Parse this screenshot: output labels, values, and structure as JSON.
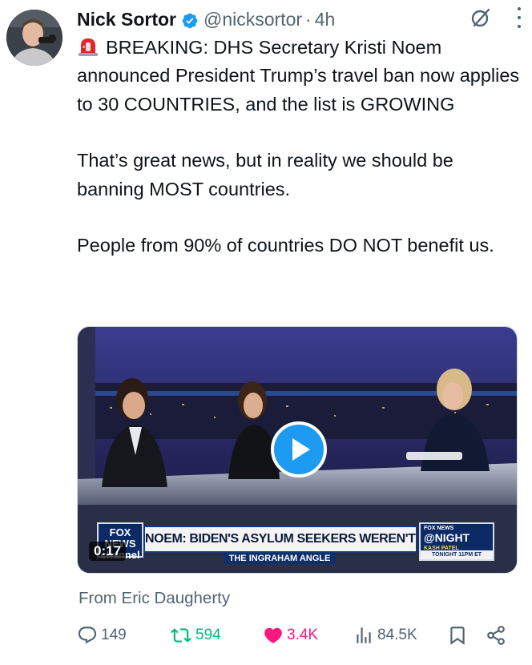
{
  "author": {
    "name": "Nick Sortor",
    "handle": "@nicksortor",
    "separator": "·",
    "time": "4h",
    "verified": true
  },
  "tweet": {
    "paragraphs": [
      "BREAKING: DHS Secretary Kristi Noem announced President Trump’s travel ban now applies to 30 COUNTRIES, and the list is GROWING",
      "That’s great news, but in reality we should be banning MOST countries.",
      "People from 90% of countries DO NOT benefit us."
    ],
    "leading_icon": "siren-emoji"
  },
  "media": {
    "type": "video",
    "duration": "0:17",
    "chyron": {
      "network_logo": "FOX NEWS channel",
      "headline": "NOEM: BIDEN'S ASYLUM SEEKERS WEREN'T VETTED",
      "show": "THE INGRAHAM ANGLE",
      "right_network": "FOX NEWS",
      "right_brand": "@NIGHT",
      "right_guest": "KASH PATEL",
      "right_slot": "TONIGHT 11PM ET"
    }
  },
  "attribution": "From Eric Daugherty",
  "metrics": {
    "replies": "149",
    "retweets": "594",
    "likes": "3.4K",
    "views": "84.5K"
  },
  "icons": {
    "verified": "verified-badge-icon",
    "grok": "grok-icon",
    "more": "more-icon",
    "reply": "reply-icon",
    "retweet": "retweet-icon",
    "like": "heart-icon",
    "views": "views-icon",
    "bookmark": "bookmark-icon",
    "share": "share-icon"
  },
  "colors": {
    "accent": "#1d9bf0",
    "retweet": "#00ba7c",
    "like": "#f91880",
    "secondary_text": "#536471"
  }
}
